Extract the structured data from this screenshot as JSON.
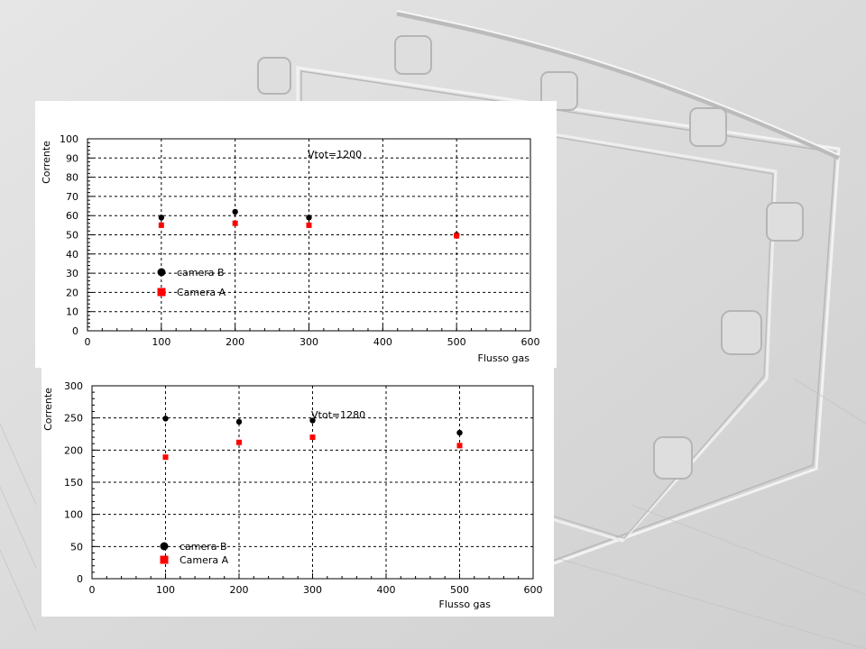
{
  "colors": {
    "background": "#d9d9d9",
    "panel": "#ffffff",
    "camera_b": "#000000",
    "camera_a": "#ff0000",
    "grid": "#000000"
  },
  "chart_data": [
    {
      "type": "scatter",
      "xlabel": "Flusso gas",
      "ylabel": "Corrente",
      "annotation": "Vtot=1200",
      "xlim": [
        0,
        600
      ],
      "ylim": [
        0,
        100
      ],
      "xticks": [
        0,
        100,
        200,
        300,
        400,
        500,
        600
      ],
      "yticks": [
        0,
        10,
        20,
        30,
        40,
        50,
        60,
        70,
        80,
        90,
        100
      ],
      "grid": true,
      "legend_position": "bottom-left",
      "series": [
        {
          "name": "camera B",
          "marker": "circle",
          "color": "#000000",
          "x": [
            100,
            200,
            300,
            500
          ],
          "y": [
            59,
            62,
            59,
            50
          ]
        },
        {
          "name": "Camera A",
          "marker": "square",
          "color": "#ff0000",
          "x": [
            100,
            200,
            300,
            500
          ],
          "y": [
            55,
            56,
            55,
            49.5
          ]
        }
      ]
    },
    {
      "type": "scatter",
      "xlabel": "Flusso gas",
      "ylabel": "Corrente",
      "annotation": "Vtot=1280",
      "xlim": [
        0,
        600
      ],
      "ylim": [
        0,
        300
      ],
      "xticks": [
        0,
        100,
        200,
        300,
        400,
        500,
        600
      ],
      "yticks": [
        0,
        50,
        100,
        150,
        200,
        250,
        300
      ],
      "grid": true,
      "legend_position": "bottom-left",
      "series": [
        {
          "name": "camera B",
          "marker": "circle",
          "color": "#000000",
          "x": [
            100,
            200,
            300,
            500
          ],
          "y": [
            249,
            244,
            246,
            227
          ]
        },
        {
          "name": "Camera A",
          "marker": "square",
          "color": "#ff0000",
          "x": [
            100,
            200,
            300,
            500
          ],
          "y": [
            189,
            212,
            220,
            207
          ]
        }
      ]
    }
  ]
}
